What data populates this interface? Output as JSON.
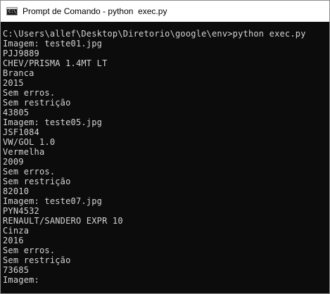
{
  "window": {
    "title": "Prompt de Comando - python  exec.py",
    "icon": "cmd-icon",
    "icon_glyph": "C:\\"
  },
  "console": {
    "lines": [
      "C:\\Users\\allef\\Desktop\\Diretorio\\google\\env>python exec.py",
      "Imagem: teste01.jpg",
      "PJJ9889",
      "CHEV/PRISMA 1.4MT LT",
      "Branca",
      "2015",
      "Sem erros.",
      "Sem restrição",
      "43805",
      "Imagem: teste05.jpg",
      "JSF1084",
      "VW/GOL 1.0",
      "Vermelha",
      "2009",
      "Sem erros.",
      "Sem restrição",
      "82010",
      "Imagem: teste07.jpg",
      "PYN4532",
      "RENAULT/SANDERO EXPR 10",
      "Cinza",
      "2016",
      "Sem erros.",
      "Sem restrição",
      "73685",
      "Imagem:"
    ]
  },
  "colors": {
    "console_background": "#0c0c0c",
    "console_text": "#d4d4d4",
    "titlebar_background": "#ffffff"
  }
}
